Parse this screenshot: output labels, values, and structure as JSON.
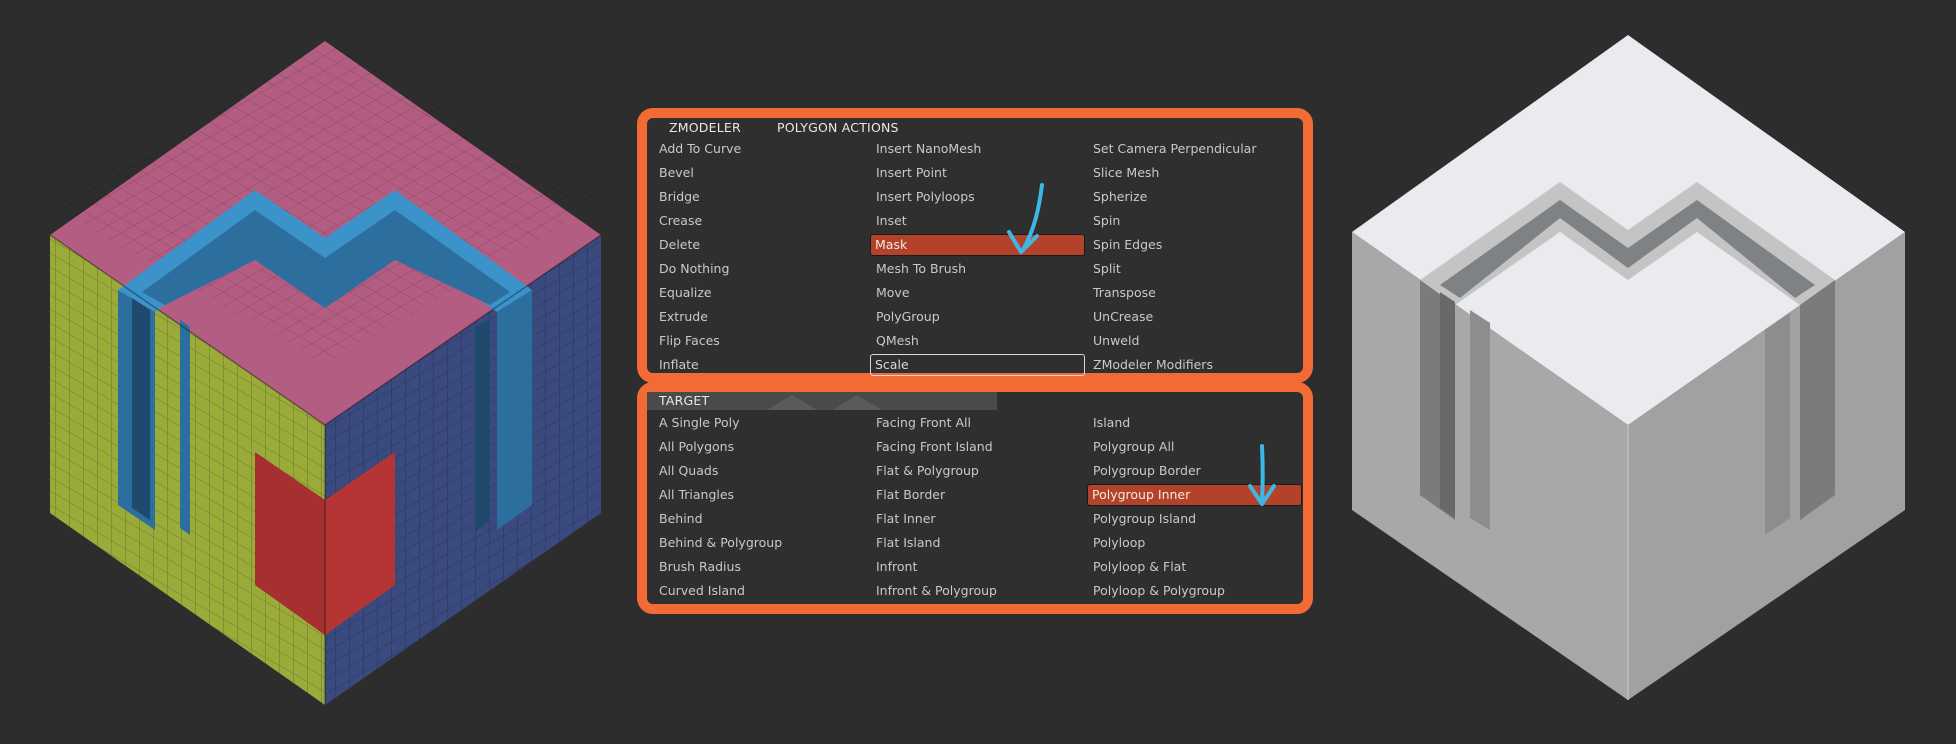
{
  "colors": {
    "background": "#2d2d2d",
    "panel_border": "#f26b35",
    "active_item": "#b2432a",
    "arrow": "#3db8e6",
    "cube_top": "#b35d82",
    "cube_left": "#9aab3a",
    "cube_right": "#3a4a7e",
    "cube_highlight": "#3c93c9",
    "cube_red": "#b53535"
  },
  "zmodeler_panel": {
    "tab_zmodeler": "ZMODELER",
    "tab_polygon_actions": "POLYGON ACTIONS",
    "columns": [
      [
        "Add To Curve",
        "Bevel",
        "Bridge",
        "Crease",
        "Delete",
        "Do Nothing",
        "Equalize",
        "Extrude",
        "Flip Faces",
        "Inflate"
      ],
      [
        "Insert NanoMesh",
        "Insert Point",
        "Insert Polyloops",
        "Inset",
        "Mask",
        "Mesh To Brush",
        "Move",
        "PolyGroup",
        "QMesh",
        "Scale"
      ],
      [
        "Set Camera Perpendicular",
        "Slice Mesh",
        "Spherize",
        "Spin",
        "Spin Edges",
        "Split",
        "Transpose",
        "UnCrease",
        "Unweld",
        "ZModeler Modifiers"
      ]
    ],
    "selected_action": "Mask",
    "outlined_action": "Scale"
  },
  "target_panel": {
    "title": "TARGET",
    "columns": [
      [
        "A Single Poly",
        "All Polygons",
        "All Quads",
        "All Triangles",
        "Behind",
        "Behind & Polygroup",
        "Brush Radius",
        "Curved Island"
      ],
      [
        "Facing Front All",
        "Facing Front Island",
        "Flat & Polygroup",
        "Flat Border",
        "Flat Inner",
        "Flat Island",
        "Infront",
        "Infront & Polygroup"
      ],
      [
        "Island",
        "Polygroup All",
        "Polygroup Border",
        "Polygroup Inner",
        "Polygroup Island",
        "Polyloop",
        "Polyloop & Flat",
        "Polyloop & Polygroup"
      ]
    ],
    "selected_target": "Polygroup Inner"
  }
}
